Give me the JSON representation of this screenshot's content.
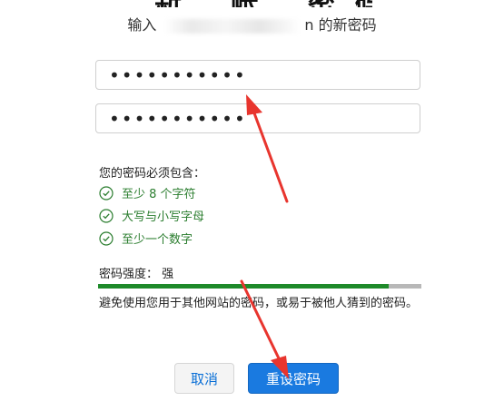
{
  "header": {
    "title_fragment": "新 帐  密码",
    "subtitle_prefix": "输入",
    "subtitle_tail": "n",
    "subtitle_suffix": "的新密码"
  },
  "form": {
    "new_password_value": "•••••••••••",
    "confirm_password_value": "•••••••••••"
  },
  "requirements": {
    "heading": "您的密码必须包含：",
    "items": [
      {
        "label": "至少 8 个字符",
        "icon": "check-circle-icon"
      },
      {
        "label": "大写与小写字母",
        "icon": "check-circle-icon"
      },
      {
        "label": "至少一个数字",
        "icon": "check-circle-icon"
      }
    ]
  },
  "strength": {
    "label": "密码强度：  强",
    "level_fraction": 0.9,
    "color": "#1e8a2a"
  },
  "advice": "避免使用您用于其他网站的密码，或易于被他人猜到的密码。",
  "buttons": {
    "cancel": "取消",
    "reset": "重设密码"
  },
  "colors": {
    "accent": "#1a7ae0",
    "success": "#2a7d2e",
    "annotation_arrow": "#e8352e"
  }
}
